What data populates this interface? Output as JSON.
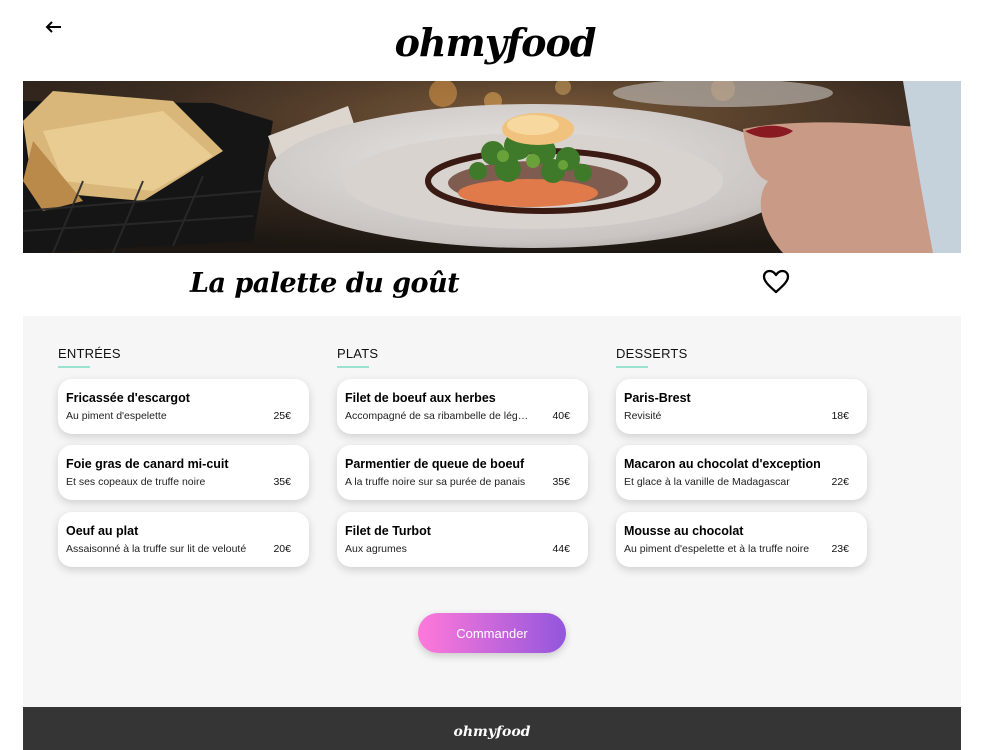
{
  "header": {
    "logo": "ohmyfood",
    "back_icon": "back-arrow-icon"
  },
  "restaurant": {
    "name": "La palette du goût",
    "favorite_icon": "heart-outline-icon"
  },
  "menu": {
    "columns": [
      {
        "title": "ENTRÉES",
        "dishes": [
          {
            "name": "Fricassée d'escargot",
            "description": "Au piment d'espelette",
            "price": "25€"
          },
          {
            "name": "Foie gras de canard mi-cuit",
            "description": "Et ses copeaux de truffe noire",
            "price": "35€"
          },
          {
            "name": "Oeuf au plat",
            "description": "Assaisonné à la truffe sur lit de velouté",
            "price": "20€"
          }
        ]
      },
      {
        "title": "PLATS",
        "dishes": [
          {
            "name": "Filet de boeuf aux herbes",
            "description": "Accompagné de sa ribambelle de légumes",
            "price": "40€"
          },
          {
            "name": "Parmentier de queue de boeuf",
            "description": "A la truffe noire sur sa purée de panais",
            "price": "35€"
          },
          {
            "name": "Filet de Turbot",
            "description": "Aux agrumes",
            "price": "44€"
          }
        ]
      },
      {
        "title": "DESSERTS",
        "dishes": [
          {
            "name": "Paris-Brest",
            "description": "Revisité",
            "price": "18€"
          },
          {
            "name": "Macaron au chocolat d'exception",
            "description": "Et glace à la vanille de Madagascar",
            "price": "22€"
          },
          {
            "name": "Mousse au chocolat",
            "description": "Au piment d'espelette et à la truffe noire",
            "price": "23€"
          }
        ]
      }
    ]
  },
  "order_button": {
    "label": "Commander"
  },
  "footer": {
    "logo": "ohmyfood"
  },
  "colors": {
    "accent_start": "#ff79da",
    "accent_end": "#9356dc",
    "underline": "#99e2d0",
    "footer_bg": "#353535"
  }
}
